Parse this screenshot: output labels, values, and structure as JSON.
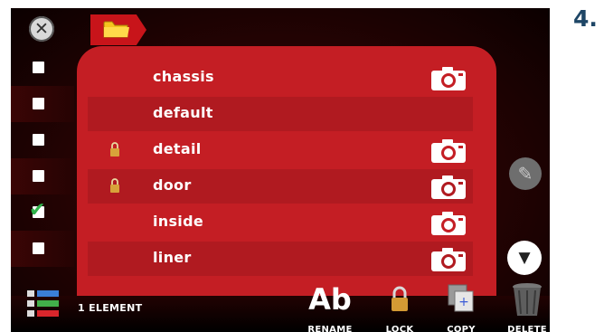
{
  "step_label": "4.",
  "header": {
    "close_icon": "close-icon",
    "folder_icon": "folder-icon"
  },
  "files": [
    {
      "name": "chassis",
      "locked": false,
      "has_photo": true,
      "checked": false
    },
    {
      "name": "default",
      "locked": false,
      "has_photo": false,
      "checked": false
    },
    {
      "name": "detail",
      "locked": true,
      "has_photo": true,
      "checked": false
    },
    {
      "name": "door",
      "locked": true,
      "has_photo": true,
      "checked": false
    },
    {
      "name": "inside",
      "locked": false,
      "has_photo": true,
      "checked": true
    },
    {
      "name": "liner",
      "locked": false,
      "has_photo": true,
      "checked": false
    }
  ],
  "footer": {
    "selection_count": "1 ELEMENT",
    "rename_glyph": "Ab",
    "rename_label": "RENAME",
    "lock_label": "LOCK",
    "copy_label": "COPY",
    "delete_label": "DELETE"
  },
  "colors": {
    "panel": "#c41e24",
    "row_alt": "#b01a20",
    "step": "#1e4666",
    "check": "#2fb24a"
  }
}
